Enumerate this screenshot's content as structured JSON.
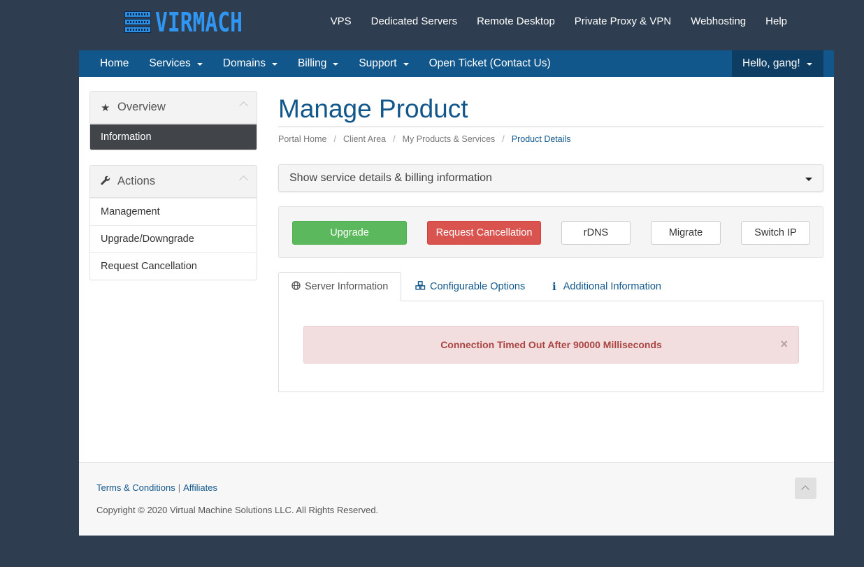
{
  "brand": {
    "logo_text": "VIRMACH",
    "accent": "#2f97f3"
  },
  "top_nav": [
    "VPS",
    "Dedicated Servers",
    "Remote Desktop",
    "Private Proxy & VPN",
    "Webhosting",
    "Help"
  ],
  "main_nav": {
    "items": [
      {
        "label": "Home",
        "dropdown": false
      },
      {
        "label": "Services",
        "dropdown": true
      },
      {
        "label": "Domains",
        "dropdown": true
      },
      {
        "label": "Billing",
        "dropdown": true
      },
      {
        "label": "Support",
        "dropdown": true
      },
      {
        "label": "Open Ticket (Contact Us)",
        "dropdown": false
      }
    ],
    "account_label": "Hello, gang!",
    "color": "#11578b"
  },
  "sidebar": {
    "overview": {
      "title": "Overview",
      "icon": "star-icon",
      "items": [
        "Information"
      ]
    },
    "actions": {
      "title": "Actions",
      "icon": "wrench-icon",
      "items": [
        "Management",
        "Upgrade/Downgrade",
        "Request Cancellation"
      ]
    }
  },
  "page": {
    "title": "Manage Product",
    "breadcrumb": [
      "Portal Home",
      "Client Area",
      "My Products & Services",
      "Product Details"
    ],
    "details_toggle": "Show service details & billing information"
  },
  "buttons": {
    "upgrade": "Upgrade",
    "request_cancellation": "Request Cancellation",
    "rdns": "rDNS",
    "migrate": "Migrate",
    "switch_ip": "Switch IP"
  },
  "tabs": [
    {
      "label": "Server Information",
      "icon": "globe-icon",
      "active": true
    },
    {
      "label": "Configurable Options",
      "icon": "cubes-icon",
      "active": false
    },
    {
      "label": "Additional Information",
      "icon": "info-icon",
      "active": false
    }
  ],
  "alert": {
    "message": "Connection Timed Out After 90000 Milliseconds",
    "close": "×"
  },
  "footer": {
    "terms": "Terms & Conditions",
    "separator": "|",
    "affiliates": "Affiliates",
    "copyright": "Copyright © 2020 Virtual Machine Solutions LLC. All Rights Reserved."
  }
}
